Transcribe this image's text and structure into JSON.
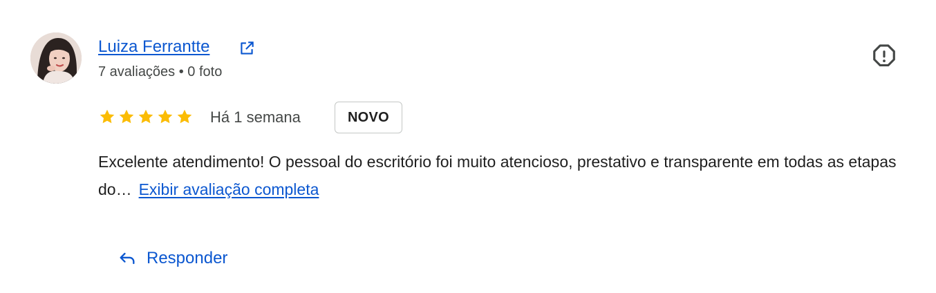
{
  "review": {
    "author": {
      "name": "Luiza Ferrantte",
      "meta": "7 avaliações • 0 foto",
      "avatar_icon": "profile-photo-avatar",
      "external_link_icon": "open-in-new-icon"
    },
    "report_icon": "report-flag-icon",
    "rating": {
      "stars": 5,
      "max": 5,
      "color": "#fbbc04"
    },
    "date": "Há 1 semana",
    "badge": "NOVO",
    "text": "Excelente atendimento! O pessoal do escritório foi muito atencioso, prestativo e transparente em todas as etapas do…",
    "more_link": "Exibir avaliação completa"
  },
  "actions": {
    "reply_label": "Responder",
    "reply_icon": "reply-arrow-icon"
  },
  "colors": {
    "link": "#0b57d0",
    "text": "#1f1f1f",
    "secondary": "#444746",
    "border": "#c4c7c5"
  }
}
